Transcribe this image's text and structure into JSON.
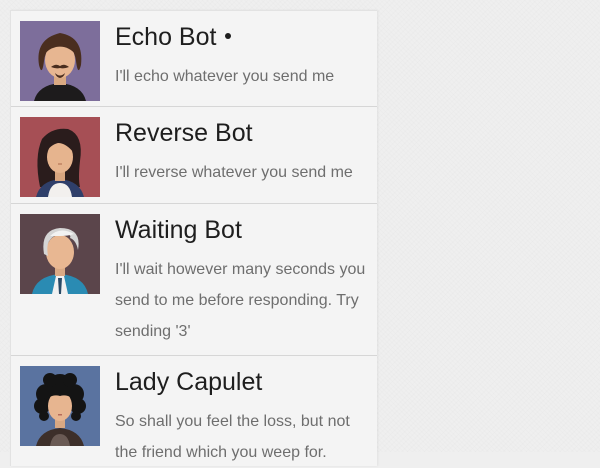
{
  "contacts": [
    {
      "name": "Echo Bot",
      "online": true,
      "description": "I'll echo whatever you send me",
      "avatar_icon": "bearded-man-avatar-icon",
      "avatar_bg": "#7d6e9b"
    },
    {
      "name": "Reverse Bot",
      "online": false,
      "description": "I'll reverse whatever you send me",
      "avatar_icon": "dark-haired-woman-avatar-icon",
      "avatar_bg": "#a64f55"
    },
    {
      "name": "Waiting Bot",
      "online": false,
      "description": "I'll wait however many seconds you send to me before responding. Try sending '3'",
      "avatar_icon": "gray-haired-man-avatar-icon",
      "avatar_bg": "#5b454b"
    },
    {
      "name": "Lady Capulet",
      "online": false,
      "description": "So shall you feel the loss, but not the friend which you weep for.",
      "avatar_icon": "curly-haired-woman-avatar-icon",
      "avatar_bg": "#5a73a0"
    }
  ]
}
